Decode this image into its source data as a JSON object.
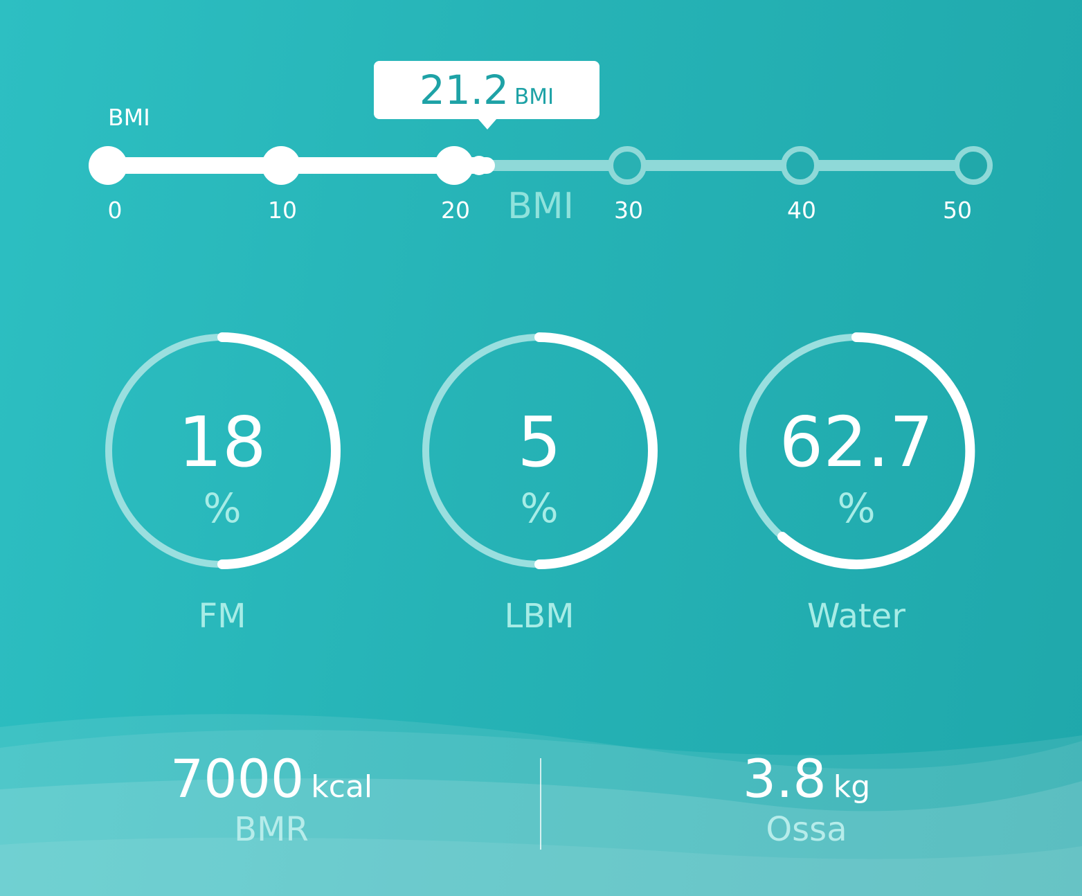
{
  "colors": {
    "background": "#26b3b6",
    "accent_text": "#1ea2a6",
    "white": "#ffffff",
    "soft_label": "#a7ece6",
    "track_inactive": "#8fd9d8"
  },
  "bmi": {
    "heading": "BMI",
    "axis_title": "BMI",
    "value": "21.2",
    "unit": "BMI",
    "value_number": 21.2,
    "scale_min": 0,
    "scale_max": 50,
    "ticks": [
      "0",
      "10",
      "20",
      "30",
      "40",
      "50"
    ]
  },
  "metrics": [
    {
      "value": "18",
      "unit": "%",
      "label": "FM",
      "progress_percent": 50
    },
    {
      "value": "5",
      "unit": "%",
      "label": "LBM",
      "progress_percent": 50
    },
    {
      "value": "62.7",
      "unit": "%",
      "label": "Water",
      "progress_percent": 62.7
    }
  ],
  "stats": {
    "bmr": {
      "value": "7000",
      "unit": "kcal",
      "label": "BMR"
    },
    "bones": {
      "value": "3.8",
      "unit": "kg",
      "label": "Ossa"
    }
  }
}
